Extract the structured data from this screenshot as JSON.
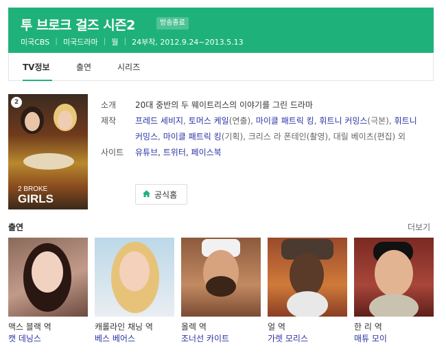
{
  "colors": {
    "accent": "#1fb17a",
    "link": "#2a33a3"
  },
  "header": {
    "title": "투 브로크 걸즈 시즌2",
    "badge": "방송종료",
    "meta": [
      "미국CBS",
      "미국드라마",
      "월",
      "24부작, 2012.9.24~2013.5.13"
    ]
  },
  "tabs": [
    {
      "label": "TV정보",
      "active": true
    },
    {
      "label": "출연",
      "active": false
    },
    {
      "label": "시리즈",
      "active": false
    }
  ],
  "poster": {
    "logo_line1": "2 BROKE",
    "logo_line2": "GIRLS",
    "badge": "2"
  },
  "info": {
    "summary_label": "소개",
    "summary": "20대 중반의 두 웨이트리스의 이야기를 그린 드라마",
    "production_label": "제작",
    "production": [
      {
        "text": "프레드 세비지",
        "link": true
      },
      {
        "text": ", ",
        "link": false
      },
      {
        "text": "토머스 케일",
        "link": true
      },
      {
        "text": "(연출), ",
        "link": false
      },
      {
        "text": "마이클 패트릭 킹",
        "link": true
      },
      {
        "text": ", ",
        "link": false
      },
      {
        "text": "휘트니 커밍스",
        "link": true
      },
      {
        "text": "(극본), ",
        "link": false
      },
      {
        "text": "휘트니 커밍스",
        "link": true
      },
      {
        "text": ", ",
        "link": false
      },
      {
        "text": "마이클 패트릭 킹",
        "link": true
      },
      {
        "text": "(기획), 크리스 라 폰테인(촬영), 대릴 베이츠(편집) 외",
        "link": false
      }
    ],
    "site_label": "사이트",
    "sites": [
      "유튜브",
      "트위터",
      "페이스북"
    ],
    "homepage_button": "공식홈"
  },
  "cast": {
    "title": "출연",
    "more": "더보기",
    "members": [
      {
        "role": "맥스 블랙 역",
        "actor": "캣 데닝스"
      },
      {
        "role": "캐롤라인 채닝 역",
        "actor": "베스 베어스"
      },
      {
        "role": "올렉 역",
        "actor": "조너선 카이트"
      },
      {
        "role": "얼 역",
        "actor": "가렛 모리스"
      },
      {
        "role": "한 리 역",
        "actor": "매튜 모이"
      }
    ]
  }
}
